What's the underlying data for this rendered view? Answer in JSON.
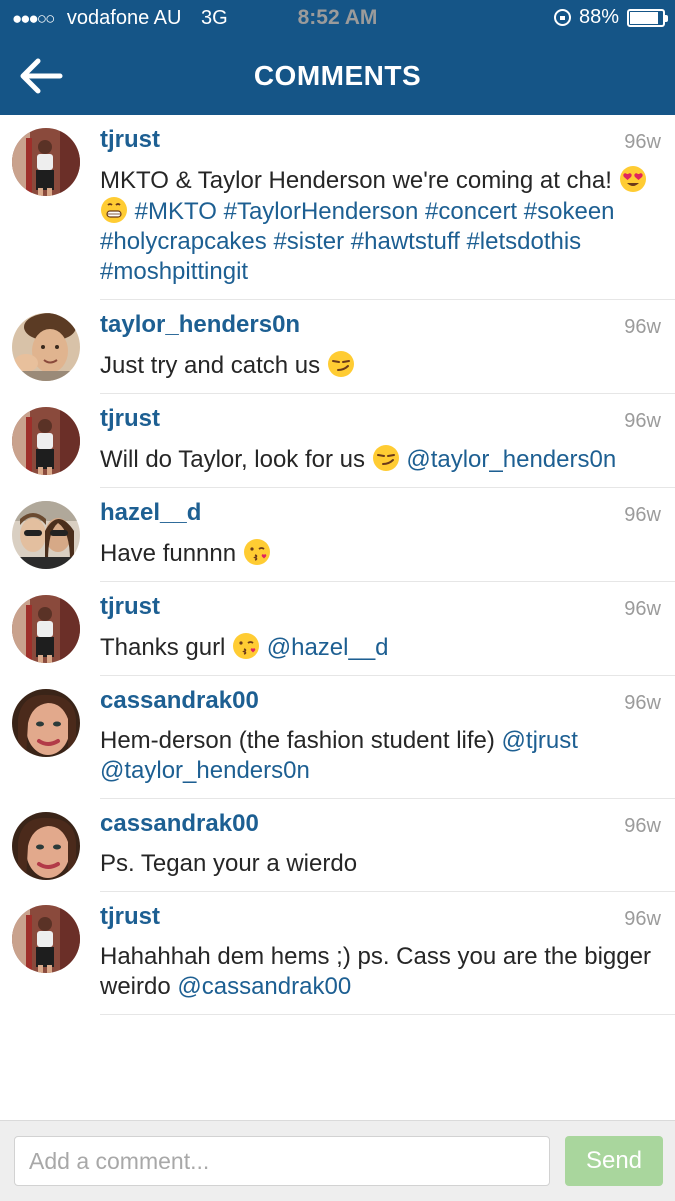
{
  "status_bar": {
    "carrier": "vodafone AU",
    "network": "3G",
    "time": "8:52 AM",
    "battery": "88%",
    "battery_level": 0.88,
    "signal_dots": "●●●○○"
  },
  "header": {
    "title": "COMMENTS",
    "back_icon": "arrow-left-icon",
    "background_color": "#155587"
  },
  "comments": [
    {
      "username": "tjrust",
      "avatar": "avatar-tjrust",
      "time": "96w",
      "text": [
        {
          "type": "text",
          "value": "MKTO & Taylor Henderson we're coming at cha! "
        },
        {
          "type": "emoji",
          "name": "heart-eyes-emoji"
        },
        {
          "type": "emoji",
          "name": "grin-emoji"
        },
        {
          "type": "text",
          "value": " "
        },
        {
          "type": "tag",
          "value": "#MKTO"
        },
        {
          "type": "text",
          "value": " "
        },
        {
          "type": "tag",
          "value": "#TaylorHenderson"
        },
        {
          "type": "text",
          "value": " "
        },
        {
          "type": "tag",
          "value": "#concert"
        },
        {
          "type": "text",
          "value": " "
        },
        {
          "type": "tag",
          "value": "#sokeen"
        },
        {
          "type": "text",
          "value": " "
        },
        {
          "type": "tag",
          "value": "#holycrapcakes"
        },
        {
          "type": "text",
          "value": " "
        },
        {
          "type": "tag",
          "value": "#sister"
        },
        {
          "type": "text",
          "value": " "
        },
        {
          "type": "tag",
          "value": "#hawtstuff"
        },
        {
          "type": "text",
          "value": " "
        },
        {
          "type": "tag",
          "value": "#letsdothis"
        },
        {
          "type": "text",
          "value": " "
        },
        {
          "type": "tag",
          "value": "#moshpittingit"
        }
      ]
    },
    {
      "username": "taylor_henders0n",
      "avatar": "avatar-taylor",
      "time": "96w",
      "text": [
        {
          "type": "text",
          "value": "Just try and catch us "
        },
        {
          "type": "emoji",
          "name": "smirk-emoji"
        }
      ]
    },
    {
      "username": "tjrust",
      "avatar": "avatar-tjrust",
      "time": "96w",
      "text": [
        {
          "type": "text",
          "value": "Will do Taylor, look for us "
        },
        {
          "type": "emoji",
          "name": "smirk-emoji"
        },
        {
          "type": "text",
          "value": " "
        },
        {
          "type": "tag",
          "value": "@taylor_henders0n"
        }
      ]
    },
    {
      "username": "hazel__d",
      "avatar": "avatar-hazel",
      "time": "96w",
      "text": [
        {
          "type": "text",
          "value": "Have funnnn "
        },
        {
          "type": "emoji",
          "name": "kiss-emoji"
        }
      ]
    },
    {
      "username": "tjrust",
      "avatar": "avatar-tjrust",
      "time": "96w",
      "text": [
        {
          "type": "text",
          "value": "Thanks gurl "
        },
        {
          "type": "emoji",
          "name": "kiss-emoji"
        },
        {
          "type": "text",
          "value": " "
        },
        {
          "type": "tag",
          "value": "@hazel__d"
        }
      ]
    },
    {
      "username": "cassandrak00",
      "avatar": "avatar-cassandra",
      "time": "96w",
      "text": [
        {
          "type": "text",
          "value": "Hem-derson (the fashion student life) "
        },
        {
          "type": "tag",
          "value": "@tjrust"
        },
        {
          "type": "text",
          "value": " "
        },
        {
          "type": "tag",
          "value": "@taylor_henders0n"
        }
      ]
    },
    {
      "username": "cassandrak00",
      "avatar": "avatar-cassandra",
      "time": "96w",
      "text": [
        {
          "type": "text",
          "value": "Ps. Tegan your a wierdo"
        }
      ]
    },
    {
      "username": "tjrust",
      "avatar": "avatar-tjrust",
      "time": "96w",
      "text": [
        {
          "type": "text",
          "value": "Hahahhah dem hems ;) ps. Cass you are the bigger weirdo "
        },
        {
          "type": "tag",
          "value": "@cassandrak00"
        }
      ]
    }
  ],
  "footer": {
    "input_placeholder": "Add a comment...",
    "input_value": "",
    "send_label": "Send",
    "send_color": "#a9d69d"
  }
}
